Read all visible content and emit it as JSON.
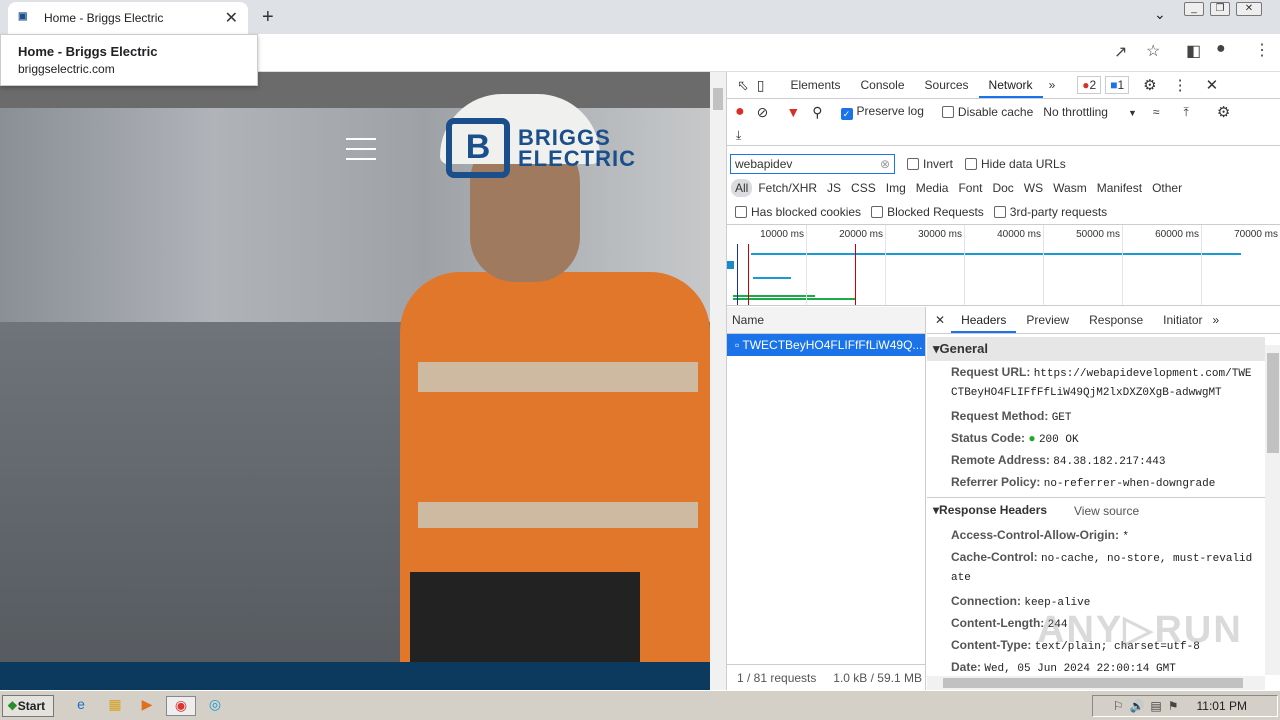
{
  "browser": {
    "tab_title": "Home - Briggs Electric",
    "new_tab": "+",
    "tooltip_title": "Home - Briggs Electric",
    "tooltip_url": "briggselectric.com"
  },
  "site": {
    "logo_line1": "BRIGGS",
    "logo_line2": "ELECTRIC",
    "logo_mark": "B"
  },
  "devtools": {
    "tabs": [
      "Elements",
      "Console",
      "Sources",
      "Network"
    ],
    "more": "»",
    "errors": "2",
    "messages": "1",
    "preserve_log": "Preserve log",
    "disable_cache": "Disable cache",
    "throttling": "No throttling",
    "filter_value": "webapidev",
    "invert": "Invert",
    "hide_data_urls": "Hide data URLs",
    "types": [
      "All",
      "Fetch/XHR",
      "JS",
      "CSS",
      "Img",
      "Media",
      "Font",
      "Doc",
      "WS",
      "Wasm",
      "Manifest",
      "Other"
    ],
    "has_blocked_cookies": "Has blocked cookies",
    "blocked_requests": "Blocked Requests",
    "third_party": "3rd-party requests",
    "timeline_ticks": [
      "10000 ms",
      "20000 ms",
      "30000 ms",
      "40000 ms",
      "50000 ms",
      "60000 ms",
      "70000 ms"
    ],
    "name_header": "Name",
    "request_name": "TWECTBeyHO4FLIFfFfLiW49Q...",
    "status_bar": {
      "requests": "1 / 81 requests",
      "size": "1.0 kB / 59.1 MB"
    },
    "detail_tabs": [
      "Headers",
      "Preview",
      "Response",
      "Initiator"
    ],
    "general_title": "General",
    "general": [
      {
        "k": "Request URL:",
        "v": "https://webapidevelopment.com/TWE",
        "v2": "CTBeyHO4FLIFfFfLiW49QjM2lxDXZ0XgB-adwwgMT"
      },
      {
        "k": "Request Method:",
        "v": "GET"
      },
      {
        "k": "Status Code:",
        "v": "200 OK"
      },
      {
        "k": "Remote Address:",
        "v": "84.38.182.217:443"
      },
      {
        "k": "Referrer Policy:",
        "v": "no-referrer-when-downgrade"
      }
    ],
    "response_title": "Response Headers",
    "view_source": "View source",
    "response": [
      {
        "k": "Access-Control-Allow-Origin:",
        "v": "*"
      },
      {
        "k": "Cache-Control:",
        "v": "no-cache, no-store, must-revalid",
        "v2": "ate"
      },
      {
        "k": "Connection:",
        "v": "keep-alive"
      },
      {
        "k": "Content-Length:",
        "v": "244"
      },
      {
        "k": "Content-Type:",
        "v": "text/plain; charset=utf-8"
      },
      {
        "k": "Date:",
        "v": "Wed, 05 Jun 2024 22:00:14 GMT"
      }
    ]
  },
  "taskbar": {
    "start": "Start",
    "clock": "11:01 PM"
  },
  "watermark": "ANY.RUN"
}
